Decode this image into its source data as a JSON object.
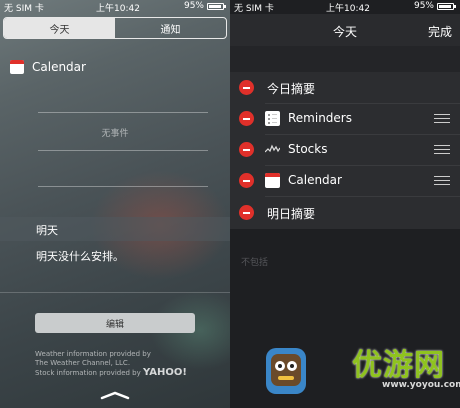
{
  "left_status": {
    "carrier": "无 SIM 卡",
    "time": "上午10:42",
    "battery": "95%"
  },
  "right_status": {
    "carrier": "无 SIM 卡",
    "time": "上午10:42",
    "battery": "95%"
  },
  "tabs": {
    "today": "今天",
    "notifications": "通知"
  },
  "calendar_widget": {
    "title": "Calendar",
    "empty_text": "无事件"
  },
  "tomorrow": {
    "header": "明天",
    "text": "明天没什么安排。"
  },
  "edit_button": "编辑",
  "credits": {
    "weather_line1": "Weather information provided by",
    "weather_line2": "The Weather Channel, LLC.",
    "stock_line": "Stock information provided by",
    "yahoo": "YAHOO!"
  },
  "edit_panel": {
    "title": "今天",
    "done": "完成",
    "items": [
      {
        "label": "今日摘要",
        "icon": "none"
      },
      {
        "label": "Reminders",
        "icon": "reminders-icon"
      },
      {
        "label": "Stocks",
        "icon": "stocks-icon"
      },
      {
        "label": "Calendar",
        "icon": "calendar-icon"
      },
      {
        "label": "明日摘要",
        "icon": "none"
      }
    ],
    "not_included": "不包括"
  },
  "watermark": {
    "name": "优游网",
    "url": "www.yoyou.com"
  },
  "colors": {
    "delete_red": "#e0302a",
    "watermark_green": "#8fc31f"
  }
}
